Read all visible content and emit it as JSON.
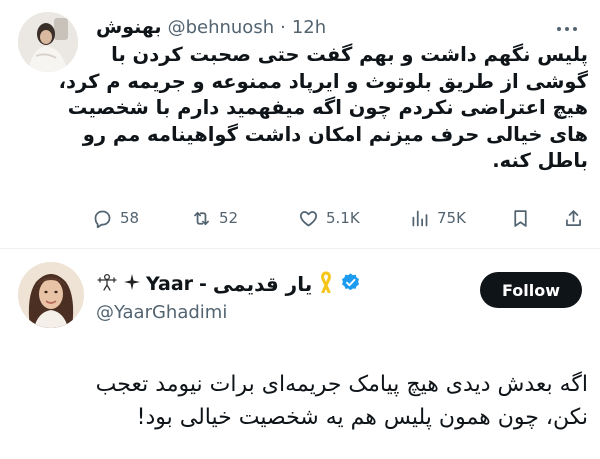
{
  "quoted_tweet": {
    "display_name": "بهنوش",
    "handle": "@behnuosh",
    "separator": "·",
    "time": "12h",
    "more_icon": "more-horizontal-icon",
    "text_lines": [
      "پلیس نگهم داشت و بهم گفت حتی صحبت کردن با",
      "گوشی از طریق بلوتوث و ایرپاد ممنوعه و جریمه م کرد،",
      "هیچ اعتراضی نکردم چون اگه میفهمید دارم با شخصیت",
      "های خیالی حرف میزنم امکان داشت گواهینامه مم رو",
      "باطل کنه."
    ],
    "actions": {
      "replies": "58",
      "retweets": "52",
      "likes": "5.1K",
      "views": "75K"
    },
    "action_color": "#536471"
  },
  "main_tweet": {
    "display_name_fa": "یار قدیمی",
    "display_name_sep": "-",
    "display_name_latin": "Yaar",
    "ribbon_icon": "yellow-ribbon-icon",
    "verified_icon": "verified-badge-icon",
    "verified_color": "#1d9bf0",
    "handle": "@YaarGhadimi",
    "follow_label": "Follow",
    "text_lines": [
      "اگه بعدش دیدی هیچ پیامک جریمه‌ای برات نیومد تعجب",
      "نکن، چون همون پلیس هم یه شخصیت خیالی بود!"
    ]
  }
}
